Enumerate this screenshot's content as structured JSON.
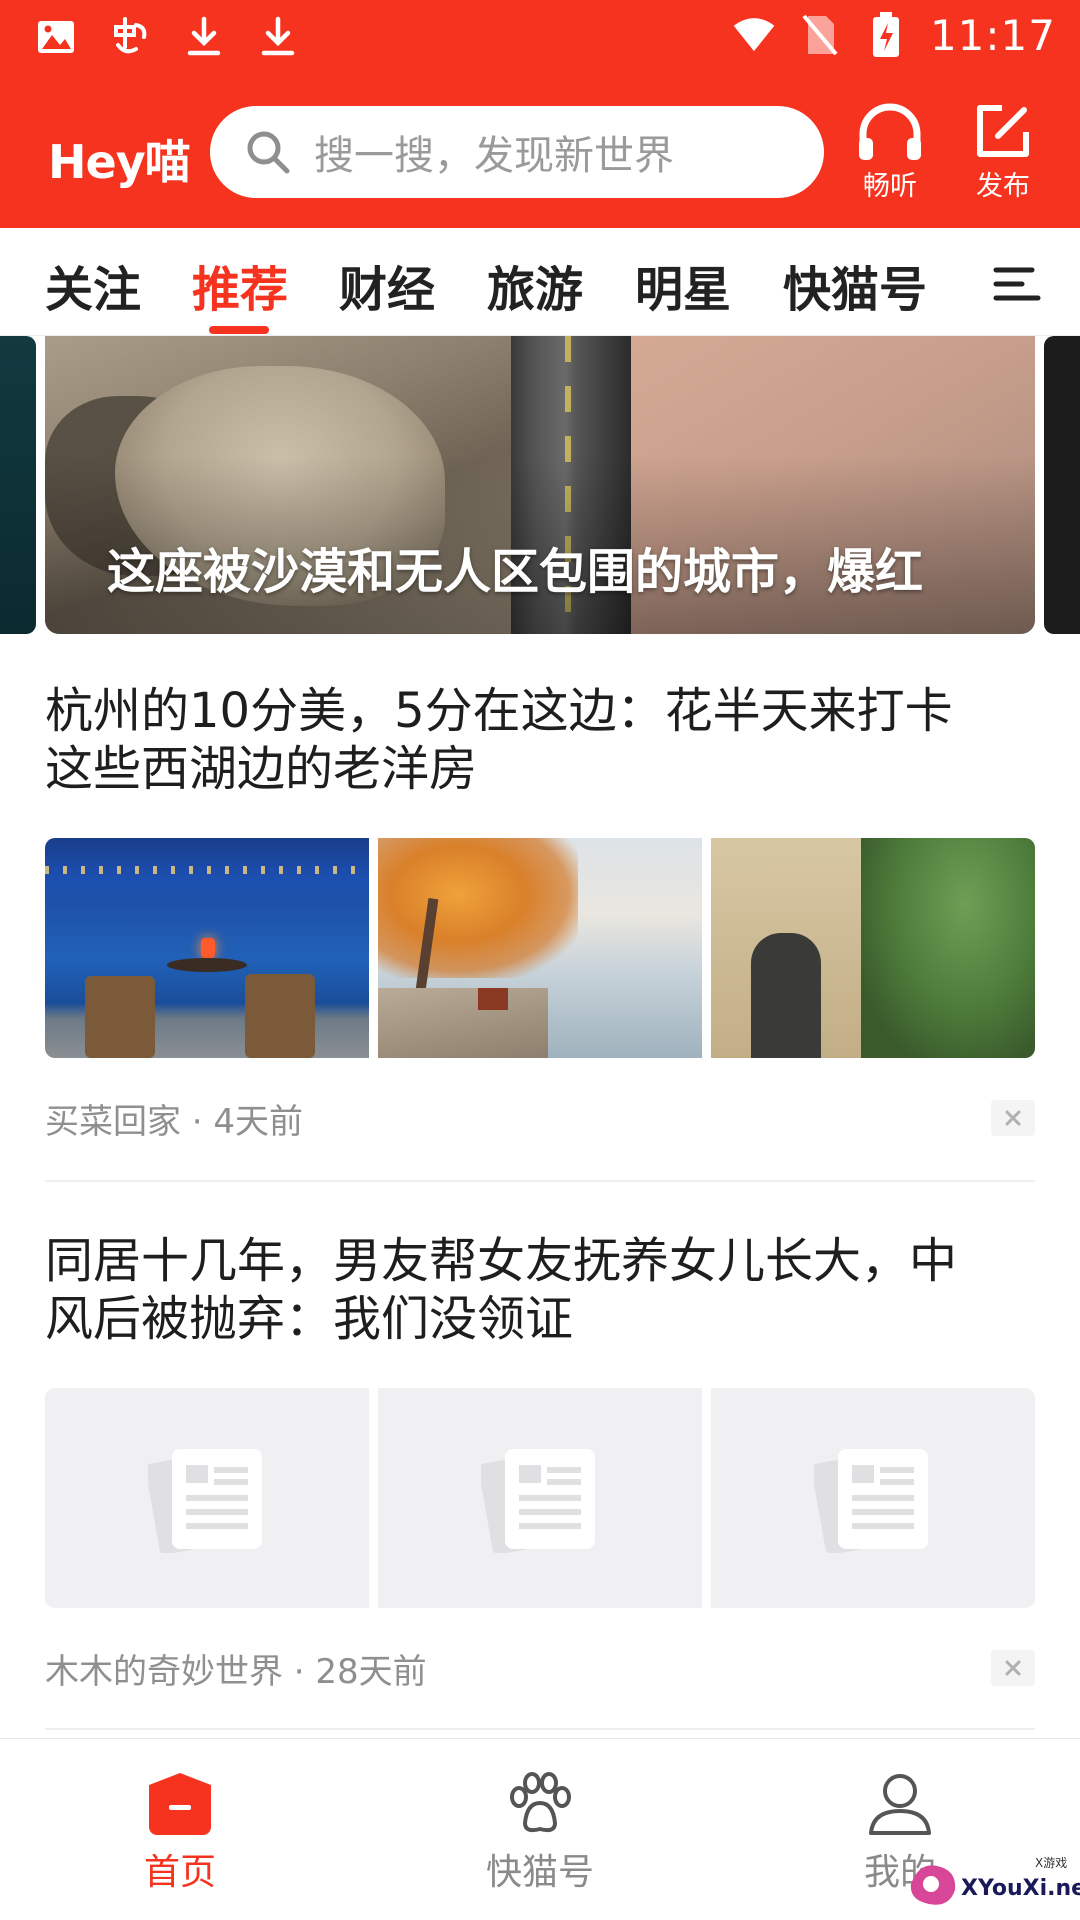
{
  "status_bar": {
    "time": "11:17",
    "left_icons": [
      "image-icon",
      "bug-icon",
      "download-icon",
      "download-icon"
    ],
    "right_icons": [
      "wifi-icon",
      "no-sim-icon",
      "battery-charging-icon"
    ]
  },
  "header": {
    "logo": "Hey喵",
    "search_placeholder": "搜一搜，发现新世界",
    "listen_label": "畅听",
    "publish_label": "发布",
    "brand_color": "#f5331f"
  },
  "tabs": [
    {
      "label": "关注",
      "active": false
    },
    {
      "label": "推荐",
      "active": true
    },
    {
      "label": "财经",
      "active": false
    },
    {
      "label": "旅游",
      "active": false
    },
    {
      "label": "明星",
      "active": false
    },
    {
      "label": "快猫号",
      "active": false
    }
  ],
  "banner": {
    "title": "这座被沙漠和无人区包围的城市，爆红"
  },
  "articles": [
    {
      "title_line1": "杭州的10分美，5分在这边：花半天来打卡",
      "title_line2": "这些西湖边的老洋房",
      "meta": "买菜回家 · 4天前",
      "images": [
        "lake-night-photo",
        "autumn-lakeside-photo",
        "old-building-photo"
      ]
    },
    {
      "title_line1": "同居十几年，男友帮女友抚养女儿长大，中",
      "title_line2": "风后被抛弃：我们没领证",
      "meta": "木木的奇妙世界 · 28天前",
      "images": [
        "placeholder-icon",
        "placeholder-icon",
        "placeholder-icon"
      ]
    }
  ],
  "bottom_nav": [
    {
      "label": "首页",
      "icon": "home-icon",
      "active": true
    },
    {
      "label": "快猫号",
      "icon": "paw-icon",
      "active": false
    },
    {
      "label": "我的",
      "icon": "user-icon",
      "active": false
    }
  ],
  "watermark": {
    "text": "XYouXi.net",
    "small": "X游戏"
  }
}
